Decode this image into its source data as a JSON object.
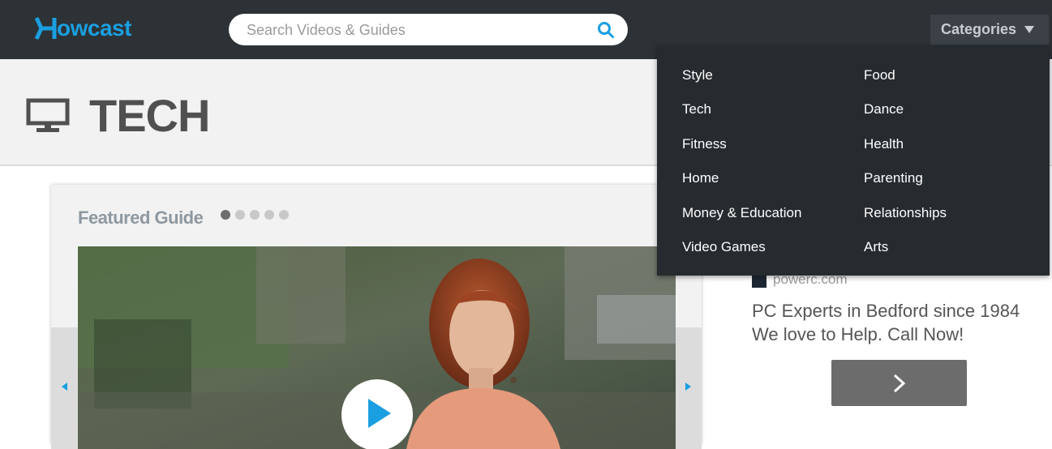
{
  "header": {
    "logo_text": "owcast",
    "search_placeholder": "Search Videos & Guides",
    "categories_label": "Categories",
    "brand_color": "#1a9fe0"
  },
  "category": {
    "title": "TECH",
    "icon": "monitor-icon"
  },
  "featured": {
    "title": "Featured Guide",
    "dots": 5,
    "active_dot": 1
  },
  "dropdown": {
    "left_column": [
      "Style",
      "Tech",
      "Fitness",
      "Home",
      "Money & Education",
      "Video Games"
    ],
    "right_column": [
      "Food",
      "Dance",
      "Health",
      "Parenting",
      "Relationships",
      "Arts"
    ]
  },
  "ad": {
    "domain": "powerc.com",
    "line1": "PC Experts in Bedford since 1984",
    "line2": "We love to Help. Call Now!"
  }
}
